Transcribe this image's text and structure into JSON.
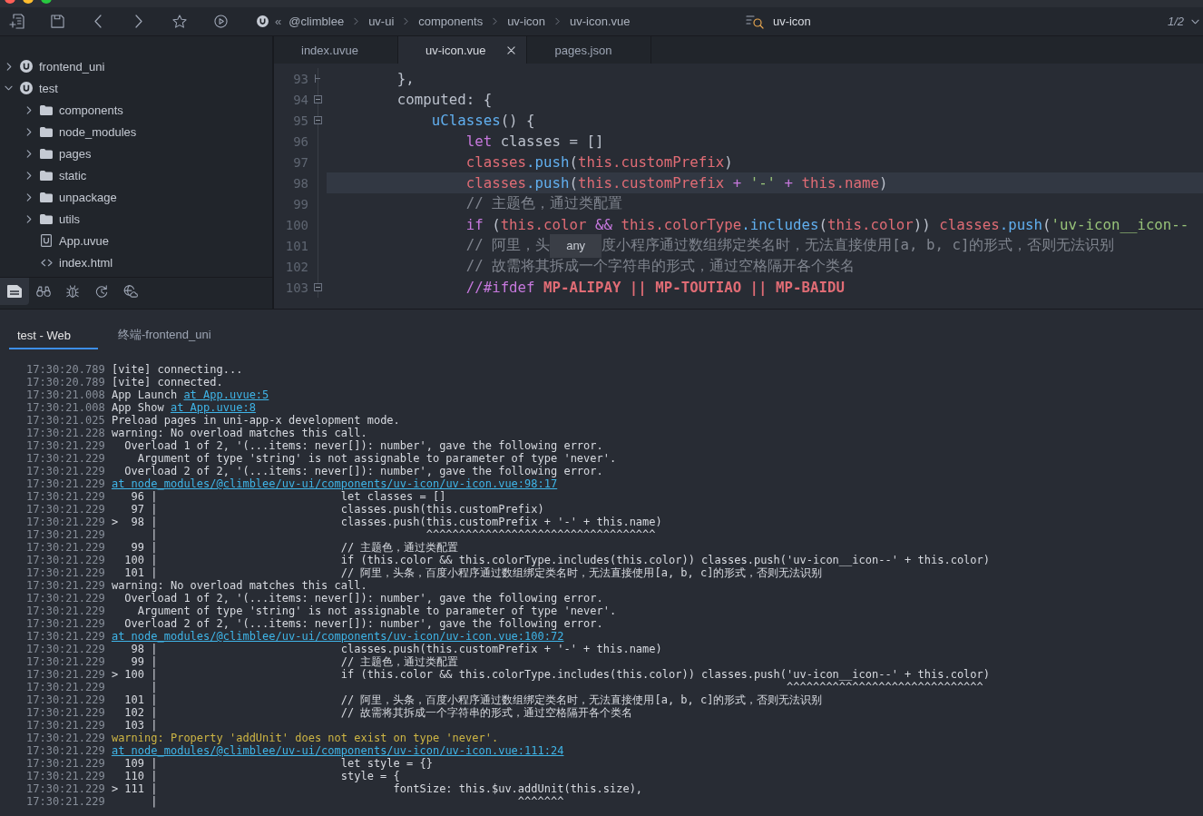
{
  "window": {
    "buttons": [
      {
        "kind": "close"
      },
      {
        "kind": "minimize"
      },
      {
        "kind": "zoom"
      }
    ]
  },
  "toolbar": {
    "buttons": [
      {
        "kind": "new-file"
      },
      {
        "kind": "save"
      },
      {
        "kind": "back"
      },
      {
        "kind": "forward"
      },
      {
        "kind": "favorite"
      },
      {
        "kind": "run"
      }
    ],
    "breadcrumb": {
      "overflow": "«",
      "items": [
        "@climblee",
        "uv-ui",
        "components",
        "uv-icon",
        "uv-icon.vue"
      ]
    },
    "find": {
      "value": "uv-icon",
      "match_count": "1/2"
    }
  },
  "sidebar": {
    "tree": [
      {
        "label": "frontend_uni",
        "kind": "project",
        "expanded": false
      },
      {
        "label": "test",
        "kind": "project",
        "expanded": true,
        "children": [
          {
            "label": "components",
            "kind": "folder",
            "expanded": false
          },
          {
            "label": "node_modules",
            "kind": "folder",
            "expanded": false
          },
          {
            "label": "pages",
            "kind": "folder",
            "expanded": false
          },
          {
            "label": "static",
            "kind": "folder",
            "expanded": false
          },
          {
            "label": "unpackage",
            "kind": "folder",
            "expanded": false
          },
          {
            "label": "utils",
            "kind": "folder",
            "expanded": false
          },
          {
            "label": "App.uvue",
            "kind": "uvue-file"
          },
          {
            "label": "index.html",
            "kind": "html-file"
          }
        ]
      }
    ],
    "views": [
      {
        "kind": "explorer",
        "selected": true
      },
      {
        "kind": "find",
        "selected": false
      },
      {
        "kind": "debug",
        "selected": false
      },
      {
        "kind": "history",
        "selected": false
      },
      {
        "kind": "cloud",
        "selected": false
      }
    ]
  },
  "editor": {
    "tabs": [
      {
        "label": "index.uvue",
        "selected": false
      },
      {
        "label": "uv-icon.vue",
        "selected": true
      },
      {
        "label": "pages.json",
        "selected": false
      }
    ],
    "lines": [
      {
        "number": "93",
        "foldable": false,
        "fold_end": true,
        "current": false,
        "tokens": [
          {
            "kind": "plain",
            "text": "},"
          }
        ]
      },
      {
        "number": "94",
        "foldable": true,
        "fold_end": false,
        "current": false,
        "tokens": [
          {
            "kind": "plain",
            "text": "computed: {"
          }
        ],
        "children": [
          {
            "number": "95",
            "foldable": true,
            "fold_end": false,
            "current": false,
            "tokens": [
              {
                "kind": "function",
                "text": "uClasses"
              },
              {
                "kind": "plain",
                "text": "() {"
              }
            ],
            "children": [
              {
                "number": "96",
                "foldable": false,
                "fold_end": false,
                "current": false,
                "tokens": [
                  {
                    "kind": "keyword",
                    "text": "let"
                  },
                  {
                    "kind": "plain",
                    "text": " classes = []"
                  }
                ]
              },
              {
                "number": "97",
                "foldable": false,
                "fold_end": false,
                "current": false,
                "tokens": [
                  {
                    "kind": "variable",
                    "text": "classes"
                  },
                  {
                    "kind": "function",
                    "text": ".push"
                  },
                  {
                    "kind": "plain",
                    "text": "("
                  },
                  {
                    "kind": "variable",
                    "text": "this.customPrefix"
                  },
                  {
                    "kind": "plain",
                    "text": ")"
                  }
                ]
              },
              {
                "number": "98",
                "foldable": false,
                "fold_end": false,
                "current": true,
                "tokens": [
                  {
                    "kind": "variable",
                    "text": "classes"
                  },
                  {
                    "kind": "function",
                    "text": ".push"
                  },
                  {
                    "kind": "plain",
                    "text": "("
                  },
                  {
                    "kind": "variable",
                    "text": "this.customPrefix"
                  },
                  {
                    "kind": "operator",
                    "text": " + "
                  },
                  {
                    "kind": "string",
                    "text": "'-'"
                  },
                  {
                    "kind": "operator",
                    "text": " + "
                  },
                  {
                    "kind": "variable",
                    "text": "this.name"
                  },
                  {
                    "kind": "plain",
                    "text": ")"
                  }
                ]
              },
              {
                "number": "99",
                "foldable": false,
                "fold_end": false,
                "current": false,
                "tokens": [
                  {
                    "kind": "comment",
                    "text": "// 主题色，通过类配置"
                  }
                ]
              },
              {
                "number": "100",
                "foldable": false,
                "fold_end": false,
                "current": false,
                "tokens": [
                  {
                    "kind": "keyword",
                    "text": "if"
                  },
                  {
                    "kind": "plain",
                    "text": " ("
                  },
                  {
                    "kind": "variable",
                    "text": "this.color"
                  },
                  {
                    "kind": "operator",
                    "text": " && "
                  },
                  {
                    "kind": "variable",
                    "text": "this.colorType"
                  },
                  {
                    "kind": "function",
                    "text": ".includes"
                  },
                  {
                    "kind": "plain",
                    "text": "("
                  },
                  {
                    "kind": "variable",
                    "text": "this.color"
                  },
                  {
                    "kind": "plain",
                    "text": ")) "
                  },
                  {
                    "kind": "variable",
                    "text": "classes"
                  },
                  {
                    "kind": "function",
                    "text": ".push"
                  },
                  {
                    "kind": "plain",
                    "text": "("
                  },
                  {
                    "kind": "string",
                    "text": "'uv-icon__icon--"
                  }
                ]
              },
              {
                "number": "101",
                "foldable": false,
                "fold_end": false,
                "current": false,
                "tokens": [
                  {
                    "kind": "comment",
                    "text": "// 阿里，头"
                  },
                  {
                    "kind": "tooltip",
                    "text": "any"
                  },
                  {
                    "kind": "comment",
                    "text": "度小程序通过数组绑定类名时，无法直接使用[a, b, c]的形式，否则无法识别"
                  }
                ]
              },
              {
                "number": "102",
                "foldable": false,
                "fold_end": false,
                "current": false,
                "tokens": [
                  {
                    "kind": "comment",
                    "text": "// 故需将其拆成一个字符串的形式，通过空格隔开各个类名"
                  }
                ]
              },
              {
                "number": "103",
                "foldable": true,
                "fold_end": false,
                "current": false,
                "tokens": [
                  {
                    "kind": "directive",
                    "text": "//#ifdef"
                  },
                  {
                    "kind": "macro",
                    "text": " MP-ALIPAY || MP-TOUTIAO || MP-BAIDU"
                  }
                ]
              }
            ]
          }
        ]
      }
    ]
  },
  "console": {
    "tabs": [
      {
        "label": "test - Web",
        "selected": true
      },
      {
        "label": "终端-frontend_uni",
        "selected": false
      }
    ],
    "lines": [
      {
        "time": "17:30:20.789",
        "kind": "log",
        "text": "[vite] connecting..."
      },
      {
        "time": "17:30:20.789",
        "kind": "log",
        "text": "[vite] connected."
      },
      {
        "time": "17:30:21.008",
        "kind": "log",
        "text": "App Launch",
        "link": "at App.uvue:5"
      },
      {
        "time": "17:30:21.008",
        "kind": "log",
        "text": "App Show",
        "link": "at App.uvue:8"
      },
      {
        "time": "17:30:21.025",
        "kind": "log",
        "text": "Preload pages in uni-app-x development mode."
      },
      {
        "time": "17:30:21.228",
        "kind": "log",
        "text": "warning: No overload matches this call.",
        "children": [
          {
            "time": "17:30:21.229",
            "kind": "log",
            "text": "Overload 1 of 2, '(...items: never[]): number', gave the following error.",
            "children": [
              {
                "time": "17:30:21.229",
                "kind": "log",
                "text": "Argument of type 'string' is not assignable to parameter of type 'never'."
              }
            ]
          },
          {
            "time": "17:30:21.229",
            "kind": "log",
            "text": "Overload 2 of 2, '(...items: never[]): number', gave the following error."
          }
        ]
      },
      {
        "time": "17:30:21.229",
        "kind": "link",
        "link": "at node_modules/@climblee/uv-ui/components/uv-icon/uv-icon.vue:98:17"
      },
      {
        "time": "17:30:21.229",
        "kind": "source",
        "number": "96",
        "text": "|                            let classes = []"
      },
      {
        "time": "17:30:21.229",
        "kind": "source",
        "number": "97",
        "text": "|                            classes.push(this.customPrefix)"
      },
      {
        "time": "17:30:21.229",
        "kind": "source",
        "marker": ">",
        "number": "98",
        "text": "|                            classes.push(this.customPrefix + '-' + this.name)"
      },
      {
        "time": "17:30:21.229",
        "kind": "source",
        "text": "|                                         ^^^^^^^^^^^^^^^^^^^^^^^^^^^^^^^^^^^"
      },
      {
        "time": "17:30:21.229",
        "kind": "source",
        "number": "99",
        "text": "|                            // 主题色，通过类配置"
      },
      {
        "time": "17:30:21.229",
        "kind": "source",
        "number": "100",
        "text": "|                            if (this.color && this.colorType.includes(this.color)) classes.push('uv-icon__icon--' + this.color)"
      },
      {
        "time": "17:30:21.229",
        "kind": "source",
        "number": "101",
        "text": "|                            // 阿里，头条，百度小程序通过数组绑定类名时，无法直接使用[a, b, c]的形式，否则无法识别"
      },
      {
        "time": "17:30:21.229",
        "kind": "log",
        "text": "warning: No overload matches this call.",
        "children": [
          {
            "time": "17:30:21.229",
            "kind": "log",
            "text": "Overload 1 of 2, '(...items: never[]): number', gave the following error.",
            "children": [
              {
                "time": "17:30:21.229",
                "kind": "log",
                "text": "Argument of type 'string' is not assignable to parameter of type 'never'."
              }
            ]
          },
          {
            "time": "17:30:21.229",
            "kind": "log",
            "text": "Overload 2 of 2, '(...items: never[]): number', gave the following error."
          }
        ]
      },
      {
        "time": "17:30:21.229",
        "kind": "link",
        "link": "at node_modules/@climblee/uv-ui/components/uv-icon/uv-icon.vue:100:72"
      },
      {
        "time": "17:30:21.229",
        "kind": "source",
        "number": "98",
        "text": "|                            classes.push(this.customPrefix + '-' + this.name)"
      },
      {
        "time": "17:30:21.229",
        "kind": "source",
        "number": "99",
        "text": "|                            // 主题色，通过类配置"
      },
      {
        "time": "17:30:21.229",
        "kind": "source",
        "marker": ">",
        "number": "100",
        "text": "|                            if (this.color && this.colorType.includes(this.color)) classes.push('uv-icon__icon--' + this.color)"
      },
      {
        "time": "17:30:21.229",
        "kind": "source",
        "text": "|                                                                                                ^^^^^^^^^^^^^^^^^^^^^^^^^^^^^^"
      },
      {
        "time": "17:30:21.229",
        "kind": "source",
        "number": "101",
        "text": "|                            // 阿里，头条，百度小程序通过数组绑定类名时，无法直接使用[a, b, c]的形式，否则无法识别"
      },
      {
        "time": "17:30:21.229",
        "kind": "source",
        "number": "102",
        "text": "|                            // 故需将其拆成一个字符串的形式，通过空格隔开各个类名"
      },
      {
        "time": "17:30:21.229",
        "kind": "source",
        "number": "103",
        "text": "|"
      },
      {
        "time": "17:30:21.229",
        "kind": "warning",
        "text": "warning: Property 'addUnit' does not exist on type 'never'."
      },
      {
        "time": "17:30:21.229",
        "kind": "link",
        "link": "at node_modules/@climblee/uv-ui/components/uv-icon/uv-icon.vue:111:24"
      },
      {
        "time": "17:30:21.229",
        "kind": "source",
        "number": "109",
        "text": "|                            let style = {}"
      },
      {
        "time": "17:30:21.229",
        "kind": "source",
        "number": "110",
        "text": "|                            style = {"
      },
      {
        "time": "17:30:21.229",
        "kind": "source",
        "marker": ">",
        "number": "111",
        "text": "|                                    fontSize: this.$uv.addUnit(this.size),"
      },
      {
        "time": "17:30:21.229",
        "kind": "source",
        "text": "|                                                       ^^^^^^^"
      }
    ]
  }
}
